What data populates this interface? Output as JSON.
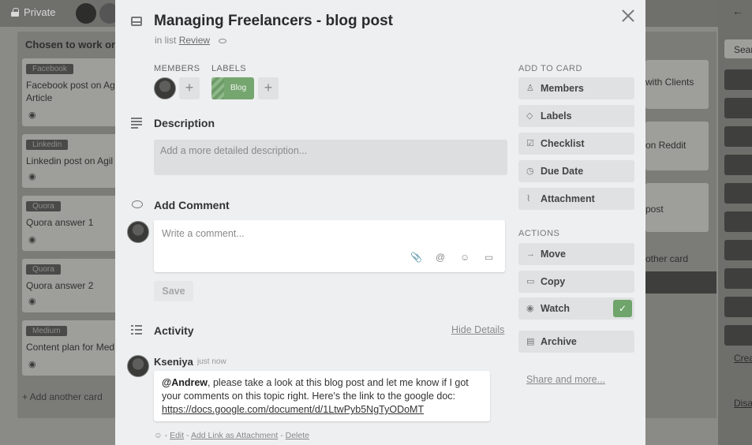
{
  "board": {
    "visibility": "Private",
    "list_title": "Chosen to work on",
    "cards": [
      {
        "label": "Facebook",
        "title": "Facebook post on Agi",
        "title2": "Article"
      },
      {
        "label": "Linkedin",
        "title": "Linkedin post on Agil"
      },
      {
        "label": "Quora",
        "title": "Quora answer 1"
      },
      {
        "label": "Quora",
        "title": "Quora answer 2"
      },
      {
        "label": "Medium",
        "title": "Content plan for Med"
      }
    ],
    "add_card": "+ Add another card",
    "right_texts": [
      "with Clients",
      "on Reddit",
      "post",
      "other card"
    ],
    "sidebar": {
      "search": "Sear",
      "create": "Crea",
      "disable": "Disa"
    }
  },
  "card": {
    "title": "Managing Freelancers - blog post",
    "in_list_prefix": "in list",
    "list_name": "Review",
    "members_label": "MEMBERS",
    "labels_label": "LABELS",
    "label_name": "Blog",
    "label_color": "#76a670",
    "plus": "+",
    "description_title": "Description",
    "description_placeholder": "Add a more detailed description...",
    "add_comment_title": "Add Comment",
    "comment_placeholder": "Write a comment...",
    "comment_tools": [
      "📎",
      "@",
      "☺",
      "▭"
    ],
    "save_label": "Save",
    "activity_title": "Activity",
    "hide_details": "Hide Details",
    "activity": {
      "author": "Kseniya",
      "time": "just now",
      "mention": "@Andrew",
      "text_1": ", please take a look at this blog post and let me know if I got",
      "text_2": "your comments on this topic right. Here's the link to the google doc:",
      "url": "https://docs.google.com/document/d/1LtwPyb5NgTyODoMT",
      "actions": {
        "icon": "☺",
        "sep": "-",
        "edit": "Edit",
        "attach": "Add Link as Attachment",
        "delete": "Delete"
      }
    }
  },
  "add_to_card": {
    "heading": "ADD TO CARD",
    "buttons": [
      {
        "icon": "♙",
        "label": "Members"
      },
      {
        "icon": "◇",
        "label": "Labels"
      },
      {
        "icon": "☑",
        "label": "Checklist"
      },
      {
        "icon": "◷",
        "label": "Due Date"
      },
      {
        "icon": "⌇",
        "label": "Attachment"
      }
    ]
  },
  "actions": {
    "heading": "ACTIONS",
    "buttons": [
      {
        "icon": "→",
        "label": "Move"
      },
      {
        "icon": "▭",
        "label": "Copy"
      },
      {
        "icon": "◉",
        "label": "Watch",
        "check": "✓"
      },
      {
        "icon": "▤",
        "label": "Archive"
      }
    ],
    "share_more": "Share and more..."
  }
}
